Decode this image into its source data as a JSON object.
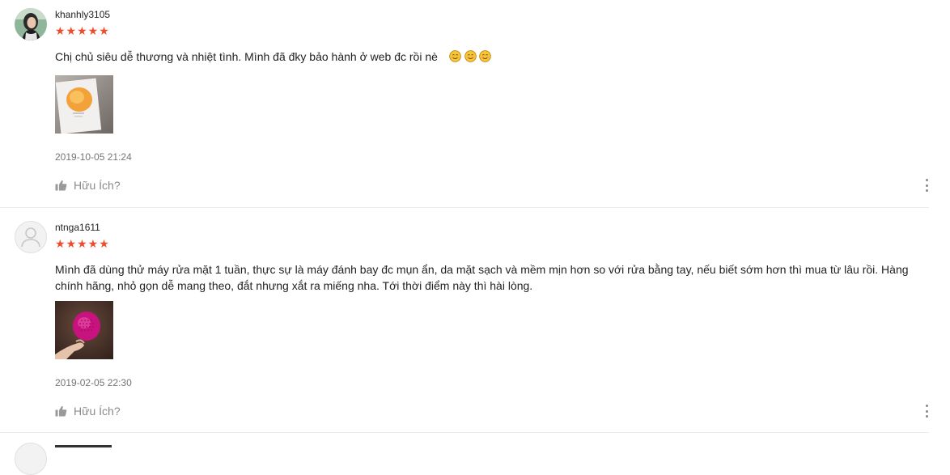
{
  "reviews": [
    {
      "username": "khanhly3105",
      "stars": "★★★★★",
      "rating": 5,
      "comment": "Chị chủ siêu dễ thương và nhiệt tình.  Mình đã đky bảo hành ở web đc rồi nè",
      "emojis": [
        "smiling-face-emoji",
        "smiling-face-emoji",
        "smiling-face-emoji"
      ],
      "time": "2019-10-05 21:24",
      "helpful_label": "Hữu Ích?"
    },
    {
      "username": "ntnga1611",
      "stars": "★★★★★",
      "rating": 5,
      "comment": "Mình đã dùng thử máy rửa mặt 1 tuần, thực sự là máy đánh bay đc mụn ẩn, da mặt sạch và mềm mịn hơn so với rửa bằng tay, nếu biết sớm hơn thì mua từ lâu rồi. Hàng chính hãng, nhỏ gọn dễ mang theo, đắt nhưng xắt ra miếng nha. Tới thời điểm này thì hài lòng.",
      "time": "2019-02-05 22:30",
      "helpful_label": "Hữu Ích?"
    }
  ],
  "colors": {
    "star": "#ee4d2d",
    "meta": "#757575",
    "divider": "#ebebeb"
  }
}
